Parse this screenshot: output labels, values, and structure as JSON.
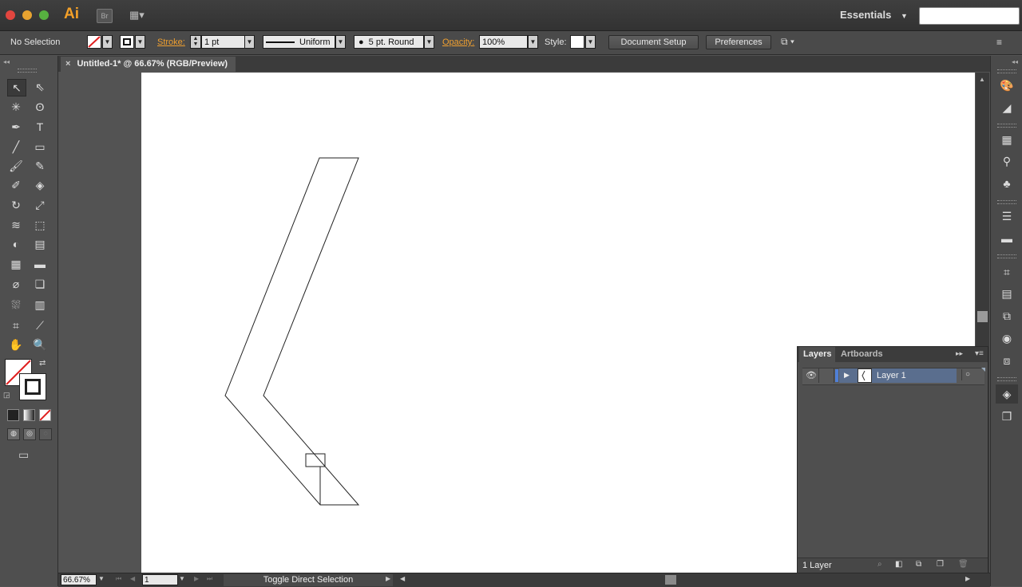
{
  "app": {
    "logo": "Ai",
    "bridge": "Br",
    "workspace": "Essentials"
  },
  "control_bar": {
    "selection_status": "No Selection",
    "stroke_label": "Stroke:",
    "stroke_weight": "1 pt",
    "profile": "Uniform",
    "brush": "5 pt. Round",
    "opacity_label": "Opacity:",
    "opacity": "100%",
    "style_label": "Style:",
    "document_setup": "Document Setup",
    "preferences": "Preferences"
  },
  "document": {
    "tab_title": "Untitled-1* @ 66.67% (RGB/Preview)",
    "close": "×"
  },
  "layers_panel": {
    "tabs": [
      "Layers",
      "Artboards"
    ],
    "layers": [
      {
        "name": "Layer 1"
      }
    ],
    "count": "1 Layer"
  },
  "status_bar": {
    "zoom": "66.67%",
    "artboard_number": "1",
    "status_text": "Toggle Direct Selection"
  },
  "icons": {
    "tools": [
      "selection-tool",
      "direct-selection-tool",
      "magic-wand-tool",
      "lasso-tool",
      "pen-tool",
      "type-tool",
      "line-tool",
      "rectangle-tool",
      "paintbrush-tool",
      "pencil-tool",
      "blob-brush-tool",
      "eraser-tool",
      "rotate-tool",
      "scale-tool",
      "width-tool",
      "free-transform-tool",
      "shape-builder-tool",
      "perspective-grid-tool",
      "mesh-tool",
      "gradient-tool",
      "eyedropper-tool",
      "blend-tool",
      "symbol-sprayer-tool",
      "column-graph-tool",
      "artboard-tool",
      "slice-tool",
      "hand-tool",
      "zoom-tool"
    ],
    "dock": [
      "color-icon",
      "color-guide-icon",
      "swatches-icon",
      "brushes-icon",
      "symbols-icon",
      "stroke-icon",
      "gradient-icon",
      "transform-icon",
      "align-icon",
      "pathfinder-icon",
      "appearance-icon",
      "graphic-styles-icon",
      "layers-icon",
      "artboards-icon"
    ]
  },
  "colors": {
    "accent_orange": "#f0a030",
    "layer_color": "#4f7fd6",
    "canvas": "#ffffff",
    "ui_dark": "#535353"
  }
}
